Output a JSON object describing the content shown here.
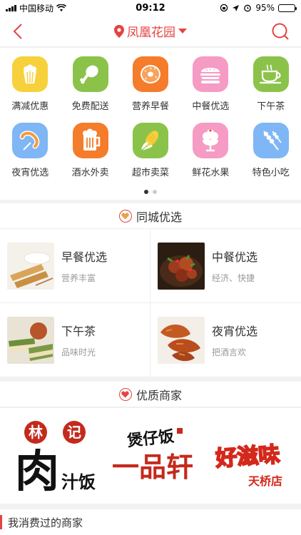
{
  "status_bar": {
    "carrier": "中国移动",
    "time": "09:12",
    "battery": "95%",
    "battery_level": 0.95
  },
  "nav": {
    "location": "凤凰花园"
  },
  "categories": [
    {
      "label": "满减优惠",
      "icon": "popcorn-icon",
      "color": "#f7d13b"
    },
    {
      "label": "免费配送",
      "icon": "drumstick-icon",
      "color": "#8bc34a"
    },
    {
      "label": "营养早餐",
      "icon": "donut-icon",
      "color": "#f57c2a"
    },
    {
      "label": "中餐优选",
      "icon": "burger-icon",
      "color": "#f59bc4"
    },
    {
      "label": "下午茶",
      "icon": "tea-cup-icon",
      "color": "#8bc34a"
    },
    {
      "label": "夜宵优选",
      "icon": "sausage-icon",
      "color": "#7fb6f5"
    },
    {
      "label": "酒水外卖",
      "icon": "beer-icon",
      "color": "#f57c2a"
    },
    {
      "label": "超市卖菜",
      "icon": "corn-icon",
      "color": "#8bc34a"
    },
    {
      "label": "鲜花水果",
      "icon": "ice-cream-icon",
      "color": "#f59bc4"
    },
    {
      "label": "特色小吃",
      "icon": "skewer-icon",
      "color": "#7fb6f5"
    }
  ],
  "pager": {
    "pages": 2,
    "current": 1
  },
  "city_section": {
    "title": "同城优选"
  },
  "picks": [
    {
      "title": "早餐优选",
      "subtitle": "营养丰富",
      "image": "breakfast-image"
    },
    {
      "title": "中餐优选",
      "subtitle": "经济、快捷",
      "image": "lunch-image"
    },
    {
      "title": "下午茶",
      "subtitle": "品味时光",
      "image": "afternoon-tea-image"
    },
    {
      "title": "夜宵优选",
      "subtitle": "把酒言欢",
      "image": "late-night-image"
    }
  ],
  "merchant_section": {
    "title": "优质商家"
  },
  "brands": [
    {
      "name": "林记肉汁饭",
      "logo_text": [
        "林",
        "记",
        "肉",
        "汁饭"
      ]
    },
    {
      "name": "煲仔饭一品轩",
      "logo_text": [
        "煲仔饭",
        "一品轩"
      ]
    },
    {
      "name": "好滋味天桥店",
      "logo_text": [
        "好滋味",
        "天桥店"
      ]
    }
  ],
  "consumed": {
    "title": "我消费过的商家"
  },
  "colors": {
    "accent": "#e64340"
  }
}
